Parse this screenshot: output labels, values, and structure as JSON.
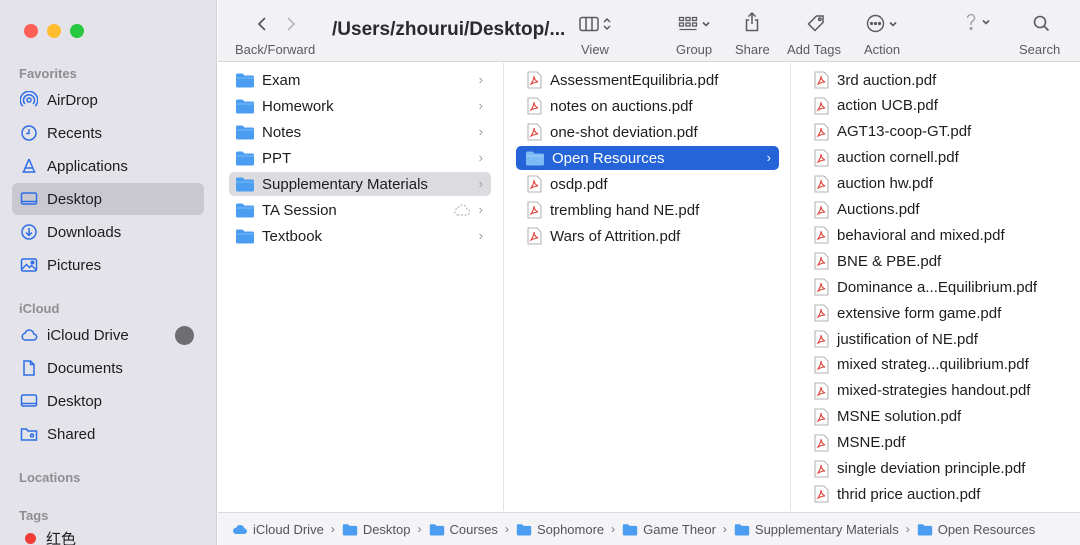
{
  "toolbar": {
    "back_forward_label": "Back/Forward",
    "path_title": "/Users/zhourui/Desktop/...",
    "view_label": "View",
    "group_label": "Group",
    "share_label": "Share",
    "add_tags_label": "Add Tags",
    "action_label": "Action",
    "search_label": "Search"
  },
  "sidebar": {
    "favorites_header": "Favorites",
    "favorites": [
      {
        "label": "AirDrop",
        "icon": "airdrop-icon"
      },
      {
        "label": "Recents",
        "icon": "clock-icon"
      },
      {
        "label": "Applications",
        "icon": "applications-icon"
      },
      {
        "label": "Desktop",
        "icon": "desktop-icon",
        "selected": true
      },
      {
        "label": "Downloads",
        "icon": "download-icon"
      },
      {
        "label": "Pictures",
        "icon": "pictures-icon"
      }
    ],
    "icloud_header": "iCloud",
    "icloud": [
      {
        "label": "iCloud Drive",
        "icon": "cloud-icon"
      },
      {
        "label": "Documents",
        "icon": "document-icon"
      },
      {
        "label": "Desktop",
        "icon": "desktop-icon"
      },
      {
        "label": "Shared",
        "icon": "shared-folder-icon"
      }
    ],
    "locations_header": "Locations",
    "tags_header": "Tags",
    "tags": [
      {
        "label": "红色",
        "color": "#f23c37"
      }
    ]
  },
  "columns": {
    "col1": [
      "Exam",
      "Homework",
      "Notes",
      "PPT",
      "Supplementary Materials",
      "TA Session",
      "Textbook"
    ],
    "col2_folders": [
      "Open Resources"
    ],
    "col2_files": [
      "AssessmentEquilibria.pdf",
      "notes on auctions.pdf",
      "one-shot deviation.pdf",
      "osdp.pdf",
      "trembling hand NE.pdf",
      "Wars of Attrition.pdf"
    ],
    "col3": [
      "3rd auction.pdf",
      "action UCB.pdf",
      "AGT13-coop-GT.pdf",
      "auction cornell.pdf",
      "auction hw.pdf",
      "Auctions.pdf",
      "behavioral and mixed.pdf",
      "BNE & PBE.pdf",
      "Dominance a...Equilibrium.pdf",
      "extensive form game.pdf",
      "justification of NE.pdf",
      "mixed strateg...quilibrium.pdf",
      "mixed-strategies handout.pdf",
      "MSNE solution.pdf",
      "MSNE.pdf",
      "single deviation principle.pdf",
      "thrid price auction.pdf"
    ]
  },
  "pathbar": [
    "iCloud Drive",
    "Desktop",
    "Courses",
    "Sophomore",
    "Game Theor",
    "Supplementary Materials",
    "Open Resources"
  ],
  "colors": {
    "accent": "#2464d8",
    "folder": "#4a9df0",
    "pdf": "#e0443a"
  }
}
